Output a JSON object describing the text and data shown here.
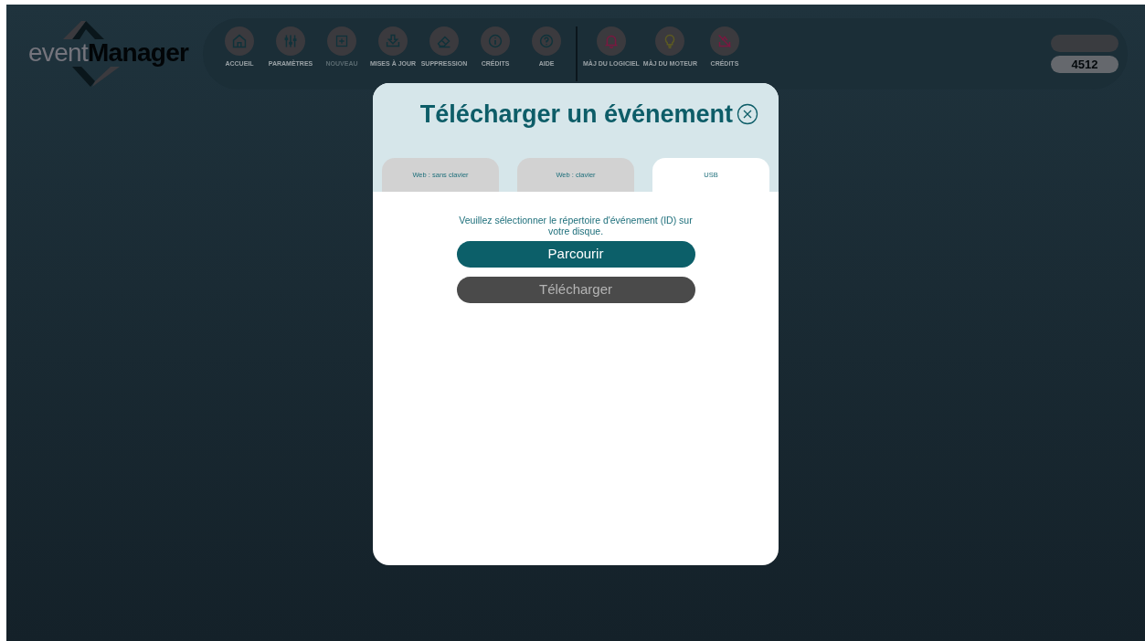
{
  "app": {
    "logo_light": "event",
    "logo_bold": "Manager"
  },
  "toolbar": [
    {
      "label": "ACCUEIL",
      "kind": "home",
      "color": "#10323a",
      "disabled": false
    },
    {
      "label": "PARAMÈTRES",
      "kind": "sliders",
      "color": "#10323a",
      "disabled": false
    },
    {
      "label": "NOUVEAU",
      "kind": "plus",
      "color": "#10323a",
      "disabled": true
    },
    {
      "label": "MISES À JOUR",
      "kind": "download",
      "color": "#10323a",
      "disabled": false
    },
    {
      "label": "SUPPRESSION",
      "kind": "eraser",
      "color": "#10323a",
      "disabled": false
    },
    {
      "label": "CRÉDITS",
      "kind": "info",
      "color": "#10323a",
      "disabled": false
    },
    {
      "label": "AIDE",
      "kind": "help",
      "color": "#10323a",
      "disabled": false
    },
    {
      "label": "MÀJ DU LOGICIEL",
      "kind": "bell",
      "color": "#7a1840",
      "disabled": false,
      "separator_before": true
    },
    {
      "label": "MÀJ DU MOTEUR",
      "kind": "bulb",
      "color": "#5c5a22",
      "disabled": false
    },
    {
      "label": "CRÉDITS",
      "kind": "nosync",
      "color": "#7a1840",
      "disabled": false
    }
  ],
  "user": {
    "code": "4512"
  },
  "dialog": {
    "title": "Télécharger un événement",
    "tabs": [
      {
        "label": "Web : sans clavier",
        "selected": false
      },
      {
        "label": "Web : clavier",
        "selected": false
      },
      {
        "label": "USB",
        "selected": true
      }
    ],
    "message": "Veuillez sélectionner le répertoire d'événement (ID) sur votre disque.",
    "buttons": [
      {
        "label": "Parcourir",
        "kind": "primary"
      },
      {
        "label": "Télécharger",
        "kind": "disabled"
      }
    ]
  }
}
